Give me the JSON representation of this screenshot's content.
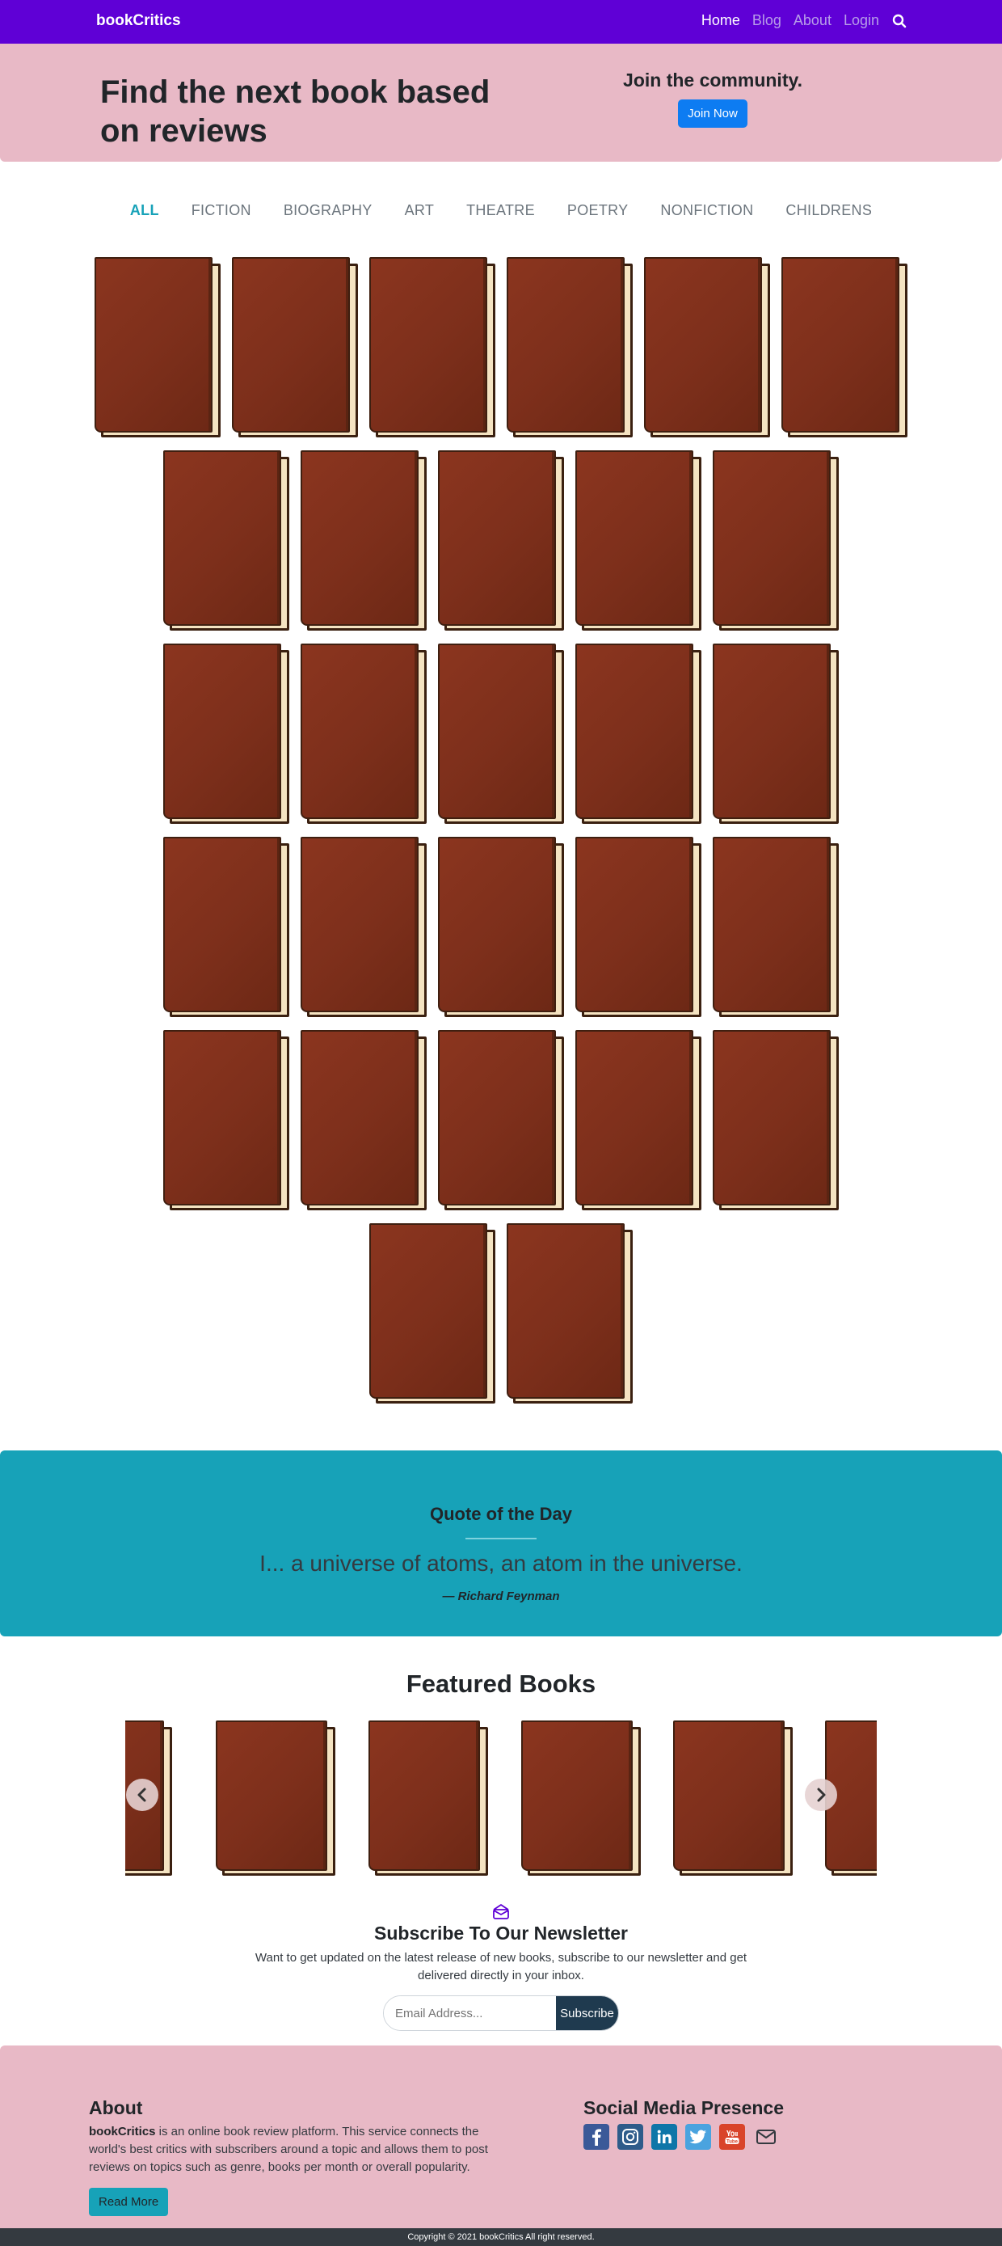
{
  "navbar": {
    "brand": "bookCritics",
    "links": [
      "Home",
      "Blog",
      "About",
      "Login"
    ],
    "search_icon": "search-icon"
  },
  "hero": {
    "heading": "Find the next book based on reviews",
    "join_text": "Join the community.",
    "join_button": "Join Now"
  },
  "categories": [
    "ALL",
    "FICTION",
    "BIOGRAPHY",
    "ART",
    "THEATRE",
    "POETRY",
    "NONFICTION",
    "CHILDRENS"
  ],
  "active_category": "ALL",
  "book_grid": {
    "rows": [
      6,
      5,
      5,
      5,
      5,
      2
    ]
  },
  "quote": {
    "heading": "Quote of the Day",
    "text": "I... a universe of atoms, an atom in the universe.",
    "author": "— Richard Feynman"
  },
  "featured": {
    "title": "Featured Books",
    "prev_icon": "chevron-left-icon",
    "next_icon": "chevron-right-icon"
  },
  "newsletter": {
    "icon": "envelope-open-icon",
    "title": "Subscribe To Our Newsletter",
    "description": "Want to get updated on the latest release of new books, subscribe to our newsletter and get delivered directly in your inbox.",
    "placeholder": "Email Address...",
    "button": "Subscribe"
  },
  "footer": {
    "about_title": "About",
    "about_brand": "bookCritics",
    "about_text": " is an online book review platform. This service connects the world's best critics with subscribers around a topic and allows them to post reviews on topics such as genre, books per month or overall popularity.",
    "read_more": "Read More",
    "social_title": "Social Media Presence",
    "social": [
      {
        "name": "facebook-icon",
        "color": "#3b5998"
      },
      {
        "name": "instagram-icon",
        "color": "#2e5c8a"
      },
      {
        "name": "linkedin-icon",
        "color": "#0e76a8"
      },
      {
        "name": "twitter-icon",
        "color": "#4aa3df"
      },
      {
        "name": "youtube-icon",
        "color": "#d9442a"
      },
      {
        "name": "envelope-icon",
        "color": "#343a40"
      }
    ],
    "copyright": "Copyright © 2021 bookCritics All right reserved."
  }
}
